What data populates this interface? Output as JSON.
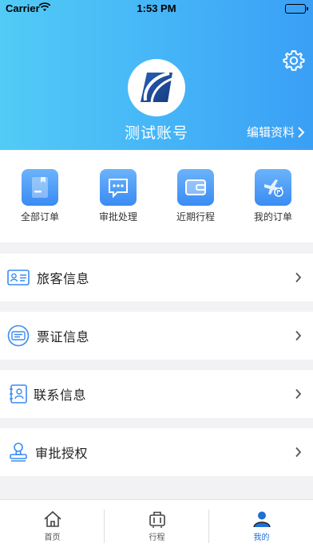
{
  "status_bar": {
    "carrier": "Carrier",
    "time": "1:53 PM"
  },
  "header": {
    "account_name": "测试账号",
    "edit_label": "编辑资料"
  },
  "quick_actions": [
    {
      "label": "全部订单",
      "icon": "document-icon"
    },
    {
      "label": "审批处理",
      "icon": "chat-bubble-icon"
    },
    {
      "label": "近期行程",
      "icon": "wallet-icon"
    },
    {
      "label": "我的订单",
      "icon": "plane-ticket-icon"
    }
  ],
  "menu": [
    {
      "label": "旅客信息",
      "icon": "id-card-icon"
    },
    {
      "label": "票证信息",
      "icon": "ticket-icon"
    },
    {
      "label": "联系信息",
      "icon": "contact-book-icon"
    },
    {
      "label": "审批授权",
      "icon": "stamp-icon"
    }
  ],
  "tabbar": [
    {
      "label": "首页",
      "icon": "home-icon",
      "active": false
    },
    {
      "label": "行程",
      "icon": "luggage-icon",
      "active": false
    },
    {
      "label": "我的",
      "icon": "user-icon",
      "active": true
    }
  ],
  "colors": {
    "accent": "#3a8bf4",
    "header_start": "#52cbf6",
    "header_end": "#3a9ff6",
    "tab_active": "#1f6fd6"
  }
}
